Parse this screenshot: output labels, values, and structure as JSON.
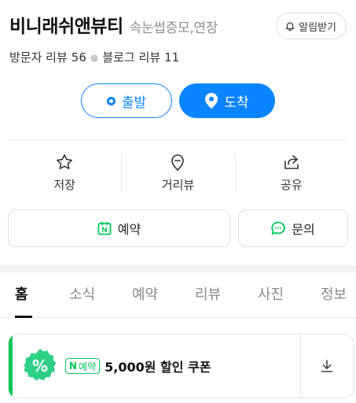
{
  "header": {
    "name": "비니래쉬앤뷰티",
    "category": "속눈썹증모,연장",
    "alert_label": "알림받기"
  },
  "stats": {
    "visitor_label": "방문자 리뷰",
    "visitor_count": "56",
    "blog_label": "블로그 리뷰",
    "blog_count": "11"
  },
  "route": {
    "depart_label": "출발",
    "arrive_label": "도착"
  },
  "actions": [
    {
      "label": "저장",
      "icon": "star-icon"
    },
    {
      "label": "거리뷰",
      "icon": "street-view-pin-icon"
    },
    {
      "label": "공유",
      "icon": "share-icon"
    }
  ],
  "buttons": {
    "reserve_label": "예약",
    "inquiry_label": "문의"
  },
  "tabs": [
    "홈",
    "소식",
    "예약",
    "리뷰",
    "사진",
    "정보"
  ],
  "active_tab": "홈",
  "coupon": {
    "badge_text": "%",
    "npay_n": "N",
    "npay_label": "예약",
    "text": "5,000원 할인 쿠폰"
  },
  "colors": {
    "primary": "#0a84ff",
    "naver_green": "#03c75a"
  }
}
